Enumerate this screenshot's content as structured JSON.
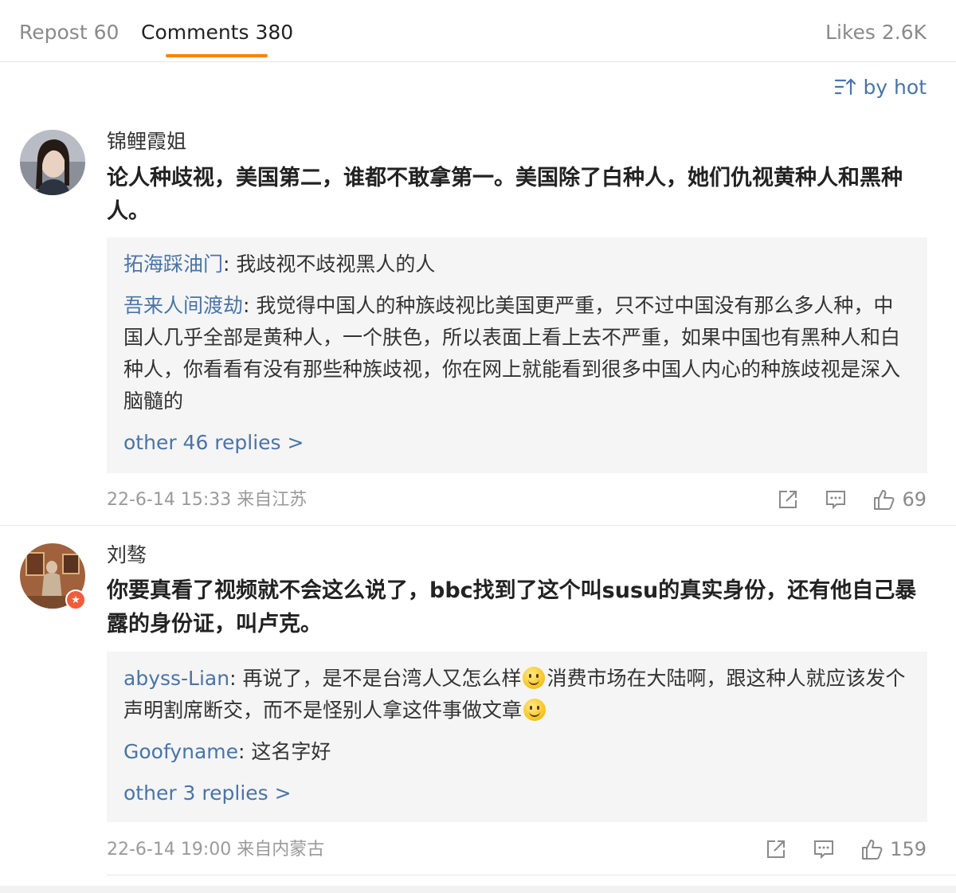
{
  "tabs": {
    "repost": "Repost 60",
    "comments": "Comments 380",
    "likes": "Likes 2.6K"
  },
  "sort": {
    "label": "by hot"
  },
  "colors": {
    "accent": "#ff8200",
    "link": "#4a74a8",
    "badge": "#f25c3c"
  },
  "comments": [
    {
      "username": "锦鲤霞姐",
      "text": "论人种歧视，美国第二，谁都不敢拿第一。美国除了白种人，她们仇视黄种人和黑种人。",
      "replies": [
        {
          "name": "拓海踩油门",
          "text": ": 我歧视不歧视黑人的人"
        },
        {
          "name": "吾来人间渡劫",
          "text": ": 我觉得中国人的种族歧视比美国更严重，只不过中国没有那么多人种，中国人几乎全部是黄种人，一个肤色，所以表面上看上去不严重，如果中国也有黑种人和白种人，你看看有没有那些种族歧视，你在网上就能看到很多中国人内心的种族歧视是深入脑髓的"
        }
      ],
      "more": "other 46 replies >",
      "meta": "22-6-14 15:33 来自江苏",
      "likes": "69"
    },
    {
      "username": "刘骜",
      "text": "你要真看了视频就不会这么说了，bbc找到了这个叫susu的真实身份，还有他自己暴露的身份证，叫卢克。",
      "replies": [
        {
          "name": "abyss-Lian",
          "text_a": ": 再说了，是不是台湾人又怎么样",
          "text_b": "消费市场在大陆啊，跟这种人就应该发个声明割席断交，而不是怪别人拿这件事做文章"
        },
        {
          "name": "Goofyname",
          "text": ": 这名字好"
        }
      ],
      "more": "other 3 replies >",
      "meta": "22-6-14 19:00 来自内蒙古",
      "likes": "159"
    }
  ],
  "icons": [
    "sort-icon",
    "share-icon",
    "comment-icon",
    "like-icon",
    "verified-badge-icon",
    "smile-emoji-icon"
  ]
}
